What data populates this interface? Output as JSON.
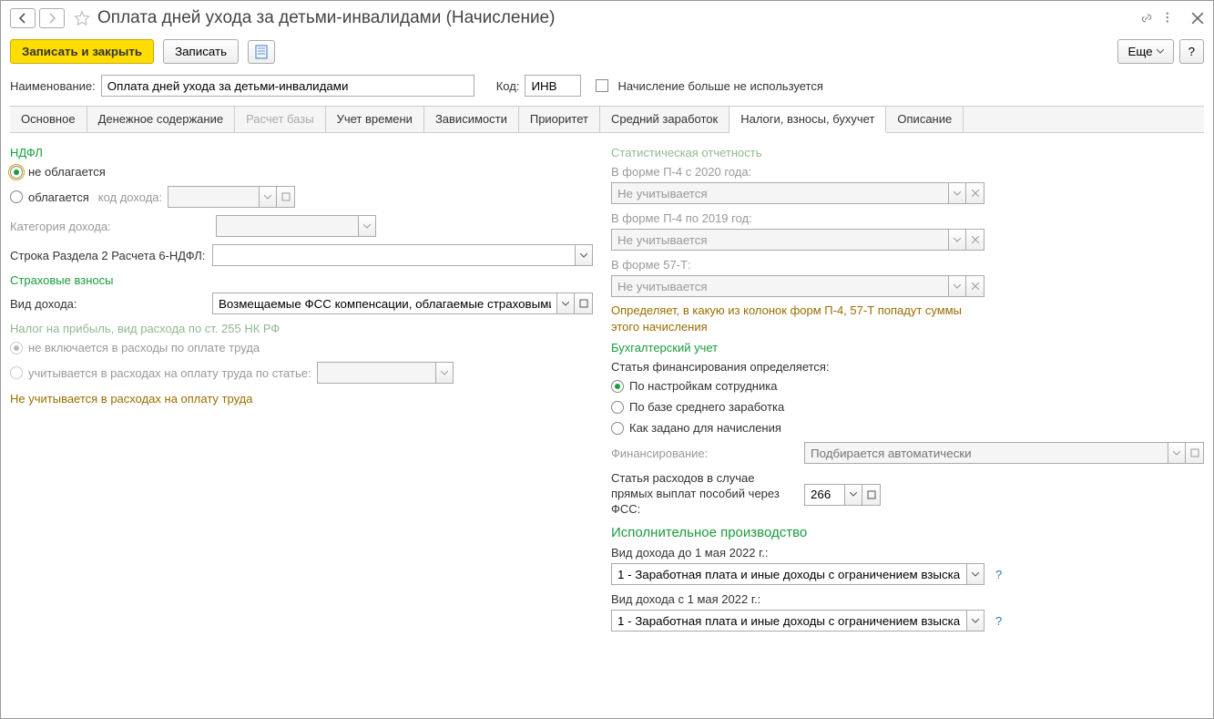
{
  "title": "Оплата дней ухода за детьми-инвалидами (Начисление)",
  "toolbar": {
    "save_close": "Записать и закрыть",
    "save": "Записать",
    "more": "Еще",
    "help": "?"
  },
  "header": {
    "name_label": "Наименование:",
    "name_value": "Оплата дней ухода за детьми-инвалидами",
    "code_label": "Код:",
    "code_value": "ИНВ",
    "unused_label": "Начисление больше не используется"
  },
  "tabs": [
    "Основное",
    "Денежное содержание",
    "Расчет базы",
    "Учет времени",
    "Зависимости",
    "Приоритет",
    "Средний заработок",
    "Налоги, взносы, бухучет",
    "Описание"
  ],
  "left": {
    "ndfl_title": "НДФЛ",
    "not_taxed": "не облагается",
    "taxed": "облагается",
    "income_code": "код дохода:",
    "category": "Категория дохода:",
    "row6": "Строка Раздела 2 Расчета 6-НДФЛ:",
    "ins_title": "Страховые взносы",
    "income_type_label": "Вид дохода:",
    "income_type_value": "Возмещаемые ФСС компенсации, облагаемые страховыми",
    "profit_title": "Налог на прибыль, вид расхода по ст. 255 НК РФ",
    "not_included": "не включается в расходы по оплате труда",
    "included": "учитывается в расходах на оплату труда по статье:",
    "note": "Не учитывается в расходах на оплату труда"
  },
  "right": {
    "stat_title": "Статистическая отчетность",
    "p4_2020": "В форме П-4 с 2020 года:",
    "p4_2019": "В форме П-4 по 2019 год:",
    "f57t": "В форме 57-Т:",
    "not_counted": "Не учитывается",
    "stat_note": "Определяет, в какую из колонок форм П-4, 57-Т попадут суммы этого начисления",
    "acc_title": "Бухгалтерский учет",
    "fin_article": "Статья финансирования определяется:",
    "by_employee": "По настройкам сотрудника",
    "by_base": "По базе среднего заработка",
    "as_set": "Как задано для начисления",
    "fin_label": "Финансирование:",
    "fin_placeholder": "Подбирается автоматически",
    "expense_label": "Статья расходов в случае прямых выплат пособий через ФСС:",
    "expense_value": "266",
    "enf_title": "Исполнительное производство",
    "inc_before": "Вид дохода до 1 мая 2022 г.:",
    "inc_after": "Вид дохода с 1 мая 2022 г.:",
    "inc_value": "1 - Заработная плата и иные доходы с ограничением взыскани"
  }
}
